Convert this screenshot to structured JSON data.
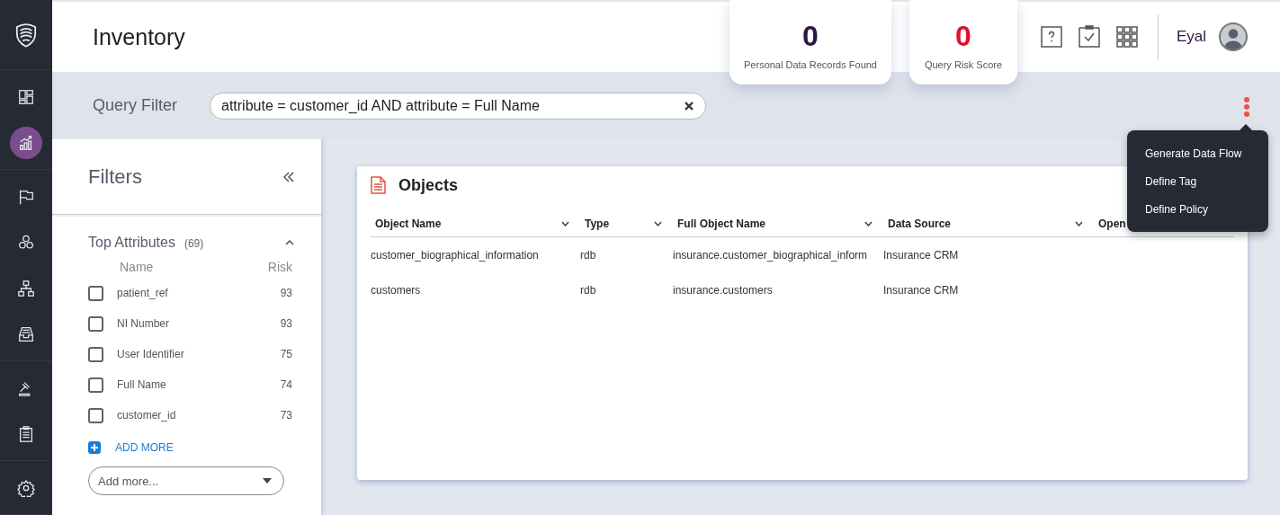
{
  "sidebar": {
    "items": [
      {
        "kind": "dashboard",
        "selected": false
      },
      {
        "kind": "analytics",
        "selected": true
      },
      {
        "kind": "flag",
        "selected": false
      },
      {
        "kind": "circles",
        "selected": false
      },
      {
        "kind": "hierarchy",
        "selected": false
      },
      {
        "kind": "tray",
        "selected": false
      },
      {
        "kind": "gavel",
        "selected": false
      },
      {
        "kind": "clipboard",
        "selected": false
      },
      {
        "kind": "settings",
        "selected": false
      }
    ]
  },
  "header": {
    "title": "Inventory",
    "stats": [
      {
        "value": "0",
        "label": "Personal Data Records Found",
        "color": "#2d1642"
      },
      {
        "value": "0",
        "label": "Query Risk Score",
        "color": "#e0102c"
      }
    ],
    "user": "Eyal"
  },
  "query_filter": {
    "label": "Query Filter",
    "value": "attribute = customer_id AND attribute = Full Name"
  },
  "menu": {
    "items": [
      "Generate Data Flow",
      "Define Tag",
      "Define Policy"
    ]
  },
  "filters": {
    "title": "Filters",
    "section": {
      "title": "Top Attributes",
      "count": "(69)",
      "expanded": true,
      "columns": [
        "Name",
        "Risk"
      ],
      "items": [
        {
          "name": "patient_ref",
          "risk": "93",
          "checked": false
        },
        {
          "name": "NI Number",
          "risk": "93",
          "checked": false
        },
        {
          "name": "User Identifier",
          "risk": "75",
          "checked": false
        },
        {
          "name": "Full Name",
          "risk": "74",
          "checked": false
        },
        {
          "name": "customer_id",
          "risk": "73",
          "checked": false
        }
      ],
      "add_more": "ADD MORE",
      "dropdown_placeholder": "Add more..."
    }
  },
  "objects": {
    "title": "Objects",
    "columns": [
      "Object Name",
      "Type",
      "Full Object Name",
      "Data Source",
      "Open"
    ],
    "rows": [
      [
        "customer_biographical_information",
        "rdb",
        "insurance.customer_biographical_inform",
        "Insurance CRM"
      ],
      [
        "customers",
        "rdb",
        "insurance.customers",
        "Insurance CRM"
      ]
    ]
  }
}
